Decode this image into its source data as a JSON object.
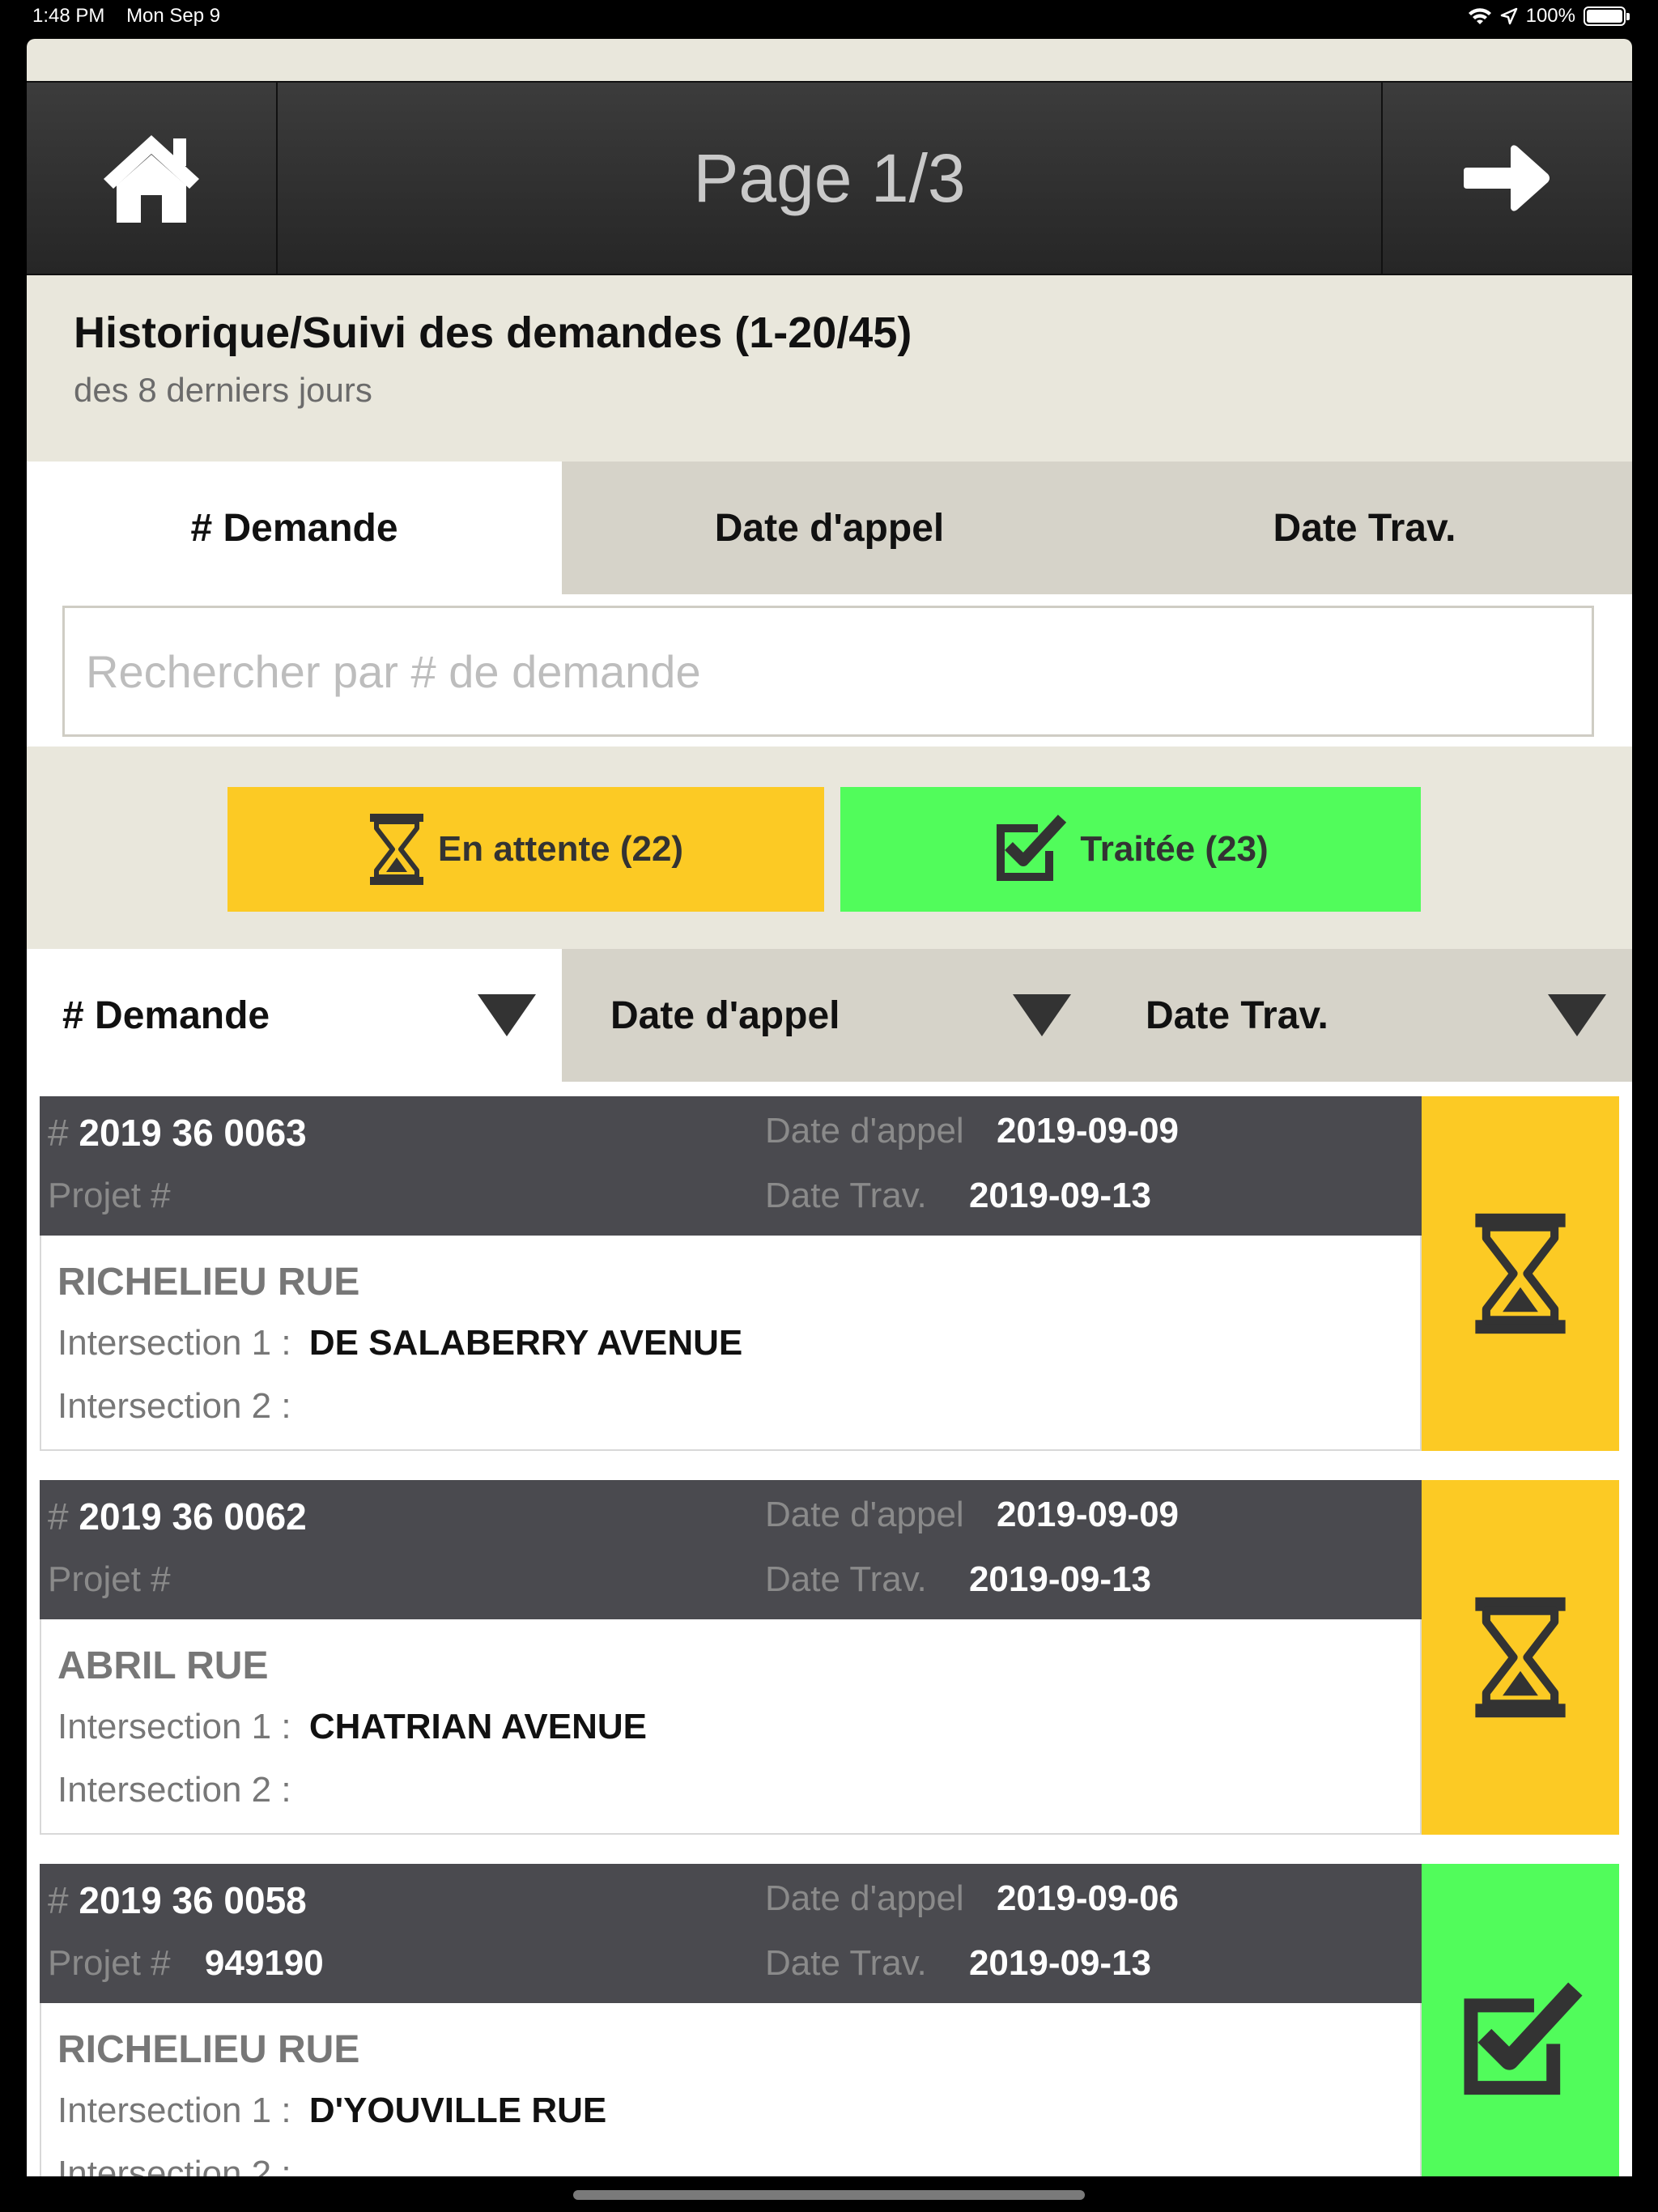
{
  "status_bar": {
    "time": "1:48 PM",
    "date": "Mon Sep 9",
    "battery": "100%"
  },
  "topbar": {
    "title": "Page 1/3",
    "home_icon": "home-icon",
    "next_icon": "arrow-right-icon"
  },
  "header": {
    "title": "Historique/Suivi des demandes (1-20/45)",
    "subtitle": "des 8 derniers jours"
  },
  "tabs": [
    {
      "label": "# Demande",
      "active": true
    },
    {
      "label": "Date d'appel",
      "active": false
    },
    {
      "label": "Date Trav.",
      "active": false
    }
  ],
  "search": {
    "placeholder": "Rechercher par # de demande",
    "value": ""
  },
  "filters": {
    "waiting": {
      "label": "En attente (22)",
      "icon": "hourglass-icon",
      "color": "#fcca24"
    },
    "done": {
      "label": "Traitée (23)",
      "icon": "checkbox-checked-icon",
      "color": "#51fc5b"
    }
  },
  "sort": [
    {
      "label": "# Demande",
      "active": true
    },
    {
      "label": "Date d'appel",
      "active": false
    },
    {
      "label": "Date Trav."
    }
  ],
  "labels": {
    "hash": "#",
    "project": "Projet #",
    "call_date": "Date d'appel",
    "work_date": "Date Trav.",
    "intersection1": "Intersection 1 :",
    "intersection2": "Intersection 2 :"
  },
  "requests": [
    {
      "number": "2019 36 0063",
      "project": "",
      "call_date": "2019-09-09",
      "work_date": "2019-09-13",
      "street": "RICHELIEU RUE",
      "intersection1": "DE SALABERRY AVENUE",
      "intersection2": "",
      "status": "waiting"
    },
    {
      "number": "2019 36 0062",
      "project": "",
      "call_date": "2019-09-09",
      "work_date": "2019-09-13",
      "street": "ABRIL RUE",
      "intersection1": "CHATRIAN AVENUE",
      "intersection2": "",
      "status": "waiting"
    },
    {
      "number": "2019 36 0058",
      "project": "949190",
      "call_date": "2019-09-06",
      "work_date": "2019-09-13",
      "street": "RICHELIEU RUE",
      "intersection1": "D'YOUVILLE RUE",
      "intersection2": "",
      "status": "done"
    }
  ]
}
